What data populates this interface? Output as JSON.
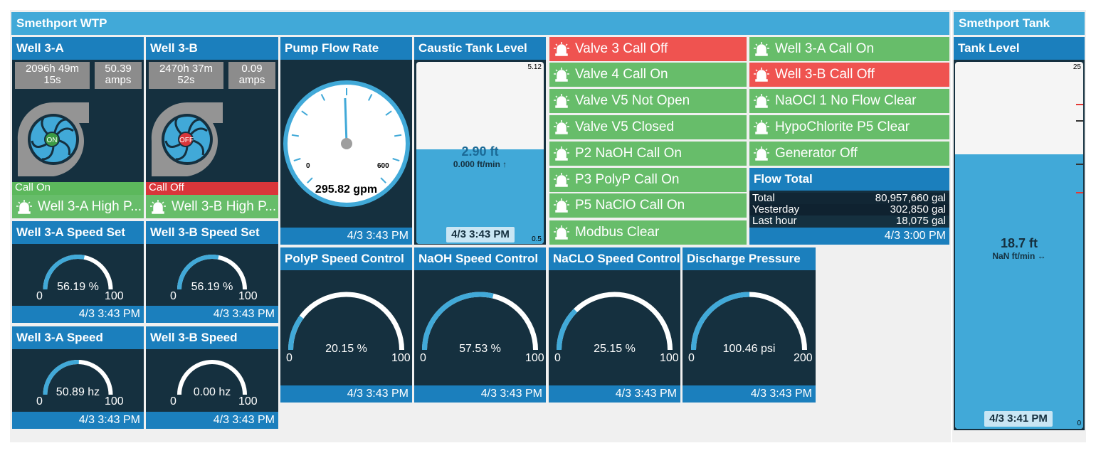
{
  "wtp": {
    "title": "Smethport WTP"
  },
  "tank_panel": {
    "title": "Smethport Tank"
  },
  "well_a": {
    "title": "Well 3-A",
    "runtime_line1": "2096h 49m",
    "runtime_line2": "15s",
    "amps_value": "50.39",
    "amps_unit": "amps",
    "pump_state": "ON",
    "status": "Call On",
    "alarm": "Well 3-A High P..."
  },
  "well_b": {
    "title": "Well 3-B",
    "runtime_line1": "2470h 37m",
    "runtime_line2": "52s",
    "amps_value": "0.09",
    "amps_unit": "amps",
    "pump_state": "OFF",
    "status": "Call Off",
    "alarm": "Well 3-B High P..."
  },
  "pump_flow": {
    "title": "Pump Flow Rate",
    "value": "295.82 gpm",
    "min": "0",
    "max": "600",
    "level": 295.82,
    "range": [
      0,
      600
    ],
    "timestamp": "4/3 3:43 PM"
  },
  "caustic": {
    "title": "Caustic Tank Level",
    "value": "2.90 ft",
    "rate": "0.000 ft/min ↑",
    "max": "5.12",
    "min": "0.5",
    "level": 2.9,
    "range": [
      0.5,
      5.12
    ],
    "timestamp": "4/3 3:43 PM"
  },
  "alarms_col1": [
    {
      "label": "Valve 3 Call Off",
      "state": "alarm"
    },
    {
      "label": "Valve 4 Call On",
      "state": "ok"
    },
    {
      "label": "Valve V5 Not Open",
      "state": "ok"
    },
    {
      "label": "Valve V5 Closed",
      "state": "ok"
    },
    {
      "label": "P2 NaOH Call On",
      "state": "ok"
    },
    {
      "label": "P3 PolyP Call On",
      "state": "ok"
    },
    {
      "label": "P5 NaClO Call On",
      "state": "ok"
    },
    {
      "label": "Modbus Clear",
      "state": "ok"
    }
  ],
  "alarms_col2": [
    {
      "label": "Well 3-A Call On",
      "state": "ok"
    },
    {
      "label": "Well 3-B Call Off",
      "state": "alarm"
    },
    {
      "label": "NaOCl 1 No Flow Clear",
      "state": "ok"
    },
    {
      "label": "HypoChlorite P5 Clear",
      "state": "ok"
    },
    {
      "label": "Generator Off",
      "state": "ok"
    }
  ],
  "flow_total": {
    "title": "Flow Total",
    "rows": [
      {
        "label": "Total",
        "value": "80,957,660 gal"
      },
      {
        "label": "Yesterday",
        "value": "302,850 gal"
      },
      {
        "label": "Last hour",
        "value": "18,075 gal"
      }
    ],
    "timestamp": "4/3 3:00 PM"
  },
  "tank_level": {
    "title": "Tank Level",
    "value": "18.7 ft",
    "rate": "NaN ft/min ↔",
    "max": "25",
    "min": "0",
    "level": 18.7,
    "range": [
      0,
      25
    ],
    "timestamp": "4/3 3:41 PM"
  },
  "gauges": {
    "speed_set_a": {
      "title": "Well 3-A Speed Set",
      "value": "56.19 %",
      "level": 56.19,
      "min": "0",
      "max": "100",
      "timestamp": "4/3 3:43 PM"
    },
    "speed_set_b": {
      "title": "Well 3-B Speed Set",
      "value": "56.19 %",
      "level": 56.19,
      "min": "0",
      "max": "100",
      "timestamp": "4/3 3:43 PM"
    },
    "speed_a": {
      "title": "Well 3-A Speed",
      "value": "50.89 hz",
      "level": 50.89,
      "min": "0",
      "max": "100",
      "timestamp": "4/3 3:43 PM"
    },
    "speed_b": {
      "title": "Well 3-B Speed",
      "value": "0.00 hz",
      "level": 0,
      "min": "0",
      "max": "100",
      "timestamp": "4/3 3:43 PM"
    },
    "polyp": {
      "title": "PolyP Speed Control",
      "value": "20.15 %",
      "level": 20.15,
      "min": "0",
      "max": "100",
      "timestamp": "4/3 3:43 PM"
    },
    "naoh": {
      "title": "NaOH Speed Control",
      "value": "57.53 %",
      "level": 57.53,
      "min": "0",
      "max": "100",
      "timestamp": "4/3 3:43 PM"
    },
    "naclo": {
      "title": "NaCLO Speed Control",
      "value": "25.15 %",
      "level": 25.15,
      "min": "0",
      "max": "100",
      "timestamp": "4/3 3:43 PM"
    },
    "discharge": {
      "title": "Discharge Pressure",
      "value": "100.46 psi",
      "level": 100.46,
      "min": "0",
      "max": "200",
      "timestamp": "4/3 3:43 PM"
    }
  },
  "colors": {
    "header": "#41a9d8",
    "card_title": "#1b7fbd",
    "card_bg": "#15303f",
    "ok": "#67bd6a",
    "alarm": "#ef5350",
    "water": "#41a9d8",
    "gauge_track": "#ffffff"
  }
}
